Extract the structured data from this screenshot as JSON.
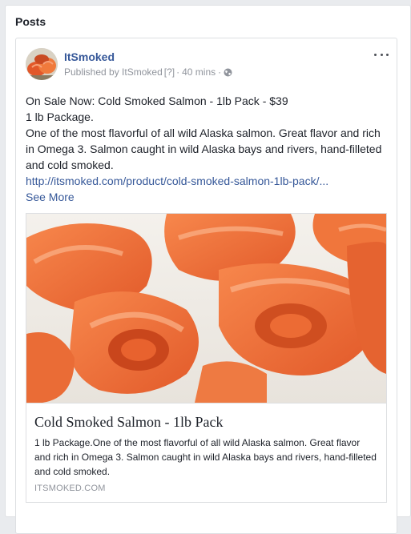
{
  "panel": {
    "title": "Posts"
  },
  "post": {
    "author": "ItSmoked",
    "meta": {
      "published_by": "Published by ItSmoked",
      "help": "[?]",
      "separator": "·",
      "time": "40 mins"
    },
    "body_lines": [
      "On Sale Now: Cold Smoked Salmon - 1lb Pack - $39",
      "1 lb Package.",
      "One of the most flavorful of all wild Alaska salmon. Great flavor and rich in Omega 3. Salmon caught in wild Alaska bays and rivers, hand-filleted and cold smoked."
    ],
    "link": "http://itsmoked.com/product/cold-smoked-salmon-1lb-pack/...",
    "see_more": "See More",
    "card": {
      "title": "Cold Smoked Salmon - 1lb Pack",
      "description": "1 lb Package.One of the most flavorful of all wild Alaska salmon. Great flavor and rich in Omega 3. Salmon caught in wild Alaska bays and rivers, hand-filleted and cold smoked.",
      "domain": "ITSMOKED.COM"
    }
  },
  "colors": {
    "link": "#365899",
    "meta": "#90949c",
    "salmon": "#f26b3a",
    "background": "#e9ebee"
  }
}
